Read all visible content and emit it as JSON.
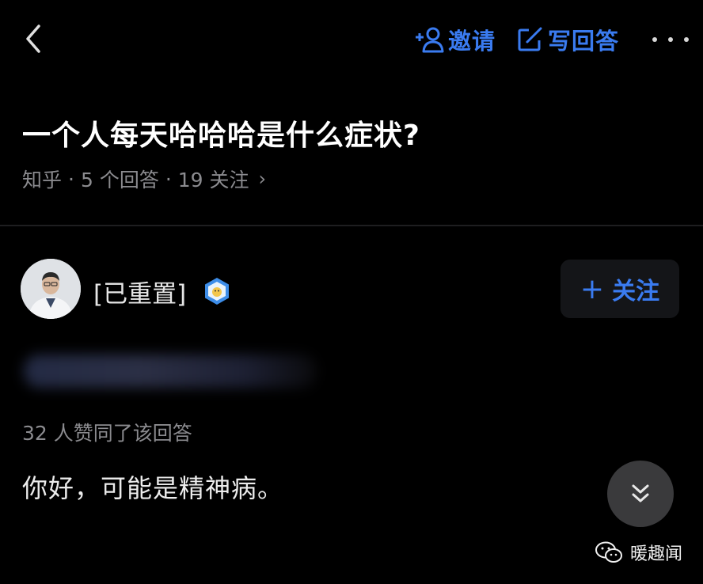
{
  "toolbar": {
    "invite_label": "邀请",
    "write_answer_label": "写回答",
    "accent_color": "#3a7bf0"
  },
  "question": {
    "title": "一个人每天哈哈哈是什么症状?",
    "source": "知乎",
    "answer_count": "5 个回答",
    "follower_count": "19 关注",
    "separator": "·",
    "chevron": "›"
  },
  "answer": {
    "author_name": "[已重置]",
    "follow_label": "关注",
    "follow_plus": "+",
    "votes_text": "32 人赞同了该回答",
    "content": "你好，可能是精神病。"
  },
  "watermark": {
    "text": "暖趣闻"
  },
  "icons": {
    "back": "chevron-left-icon",
    "invite": "add-user-icon",
    "write": "edit-icon",
    "more": "more-dots-icon",
    "badge": "verified-badge-icon",
    "scroll": "double-chevron-down-icon",
    "wechat": "wechat-icon"
  }
}
